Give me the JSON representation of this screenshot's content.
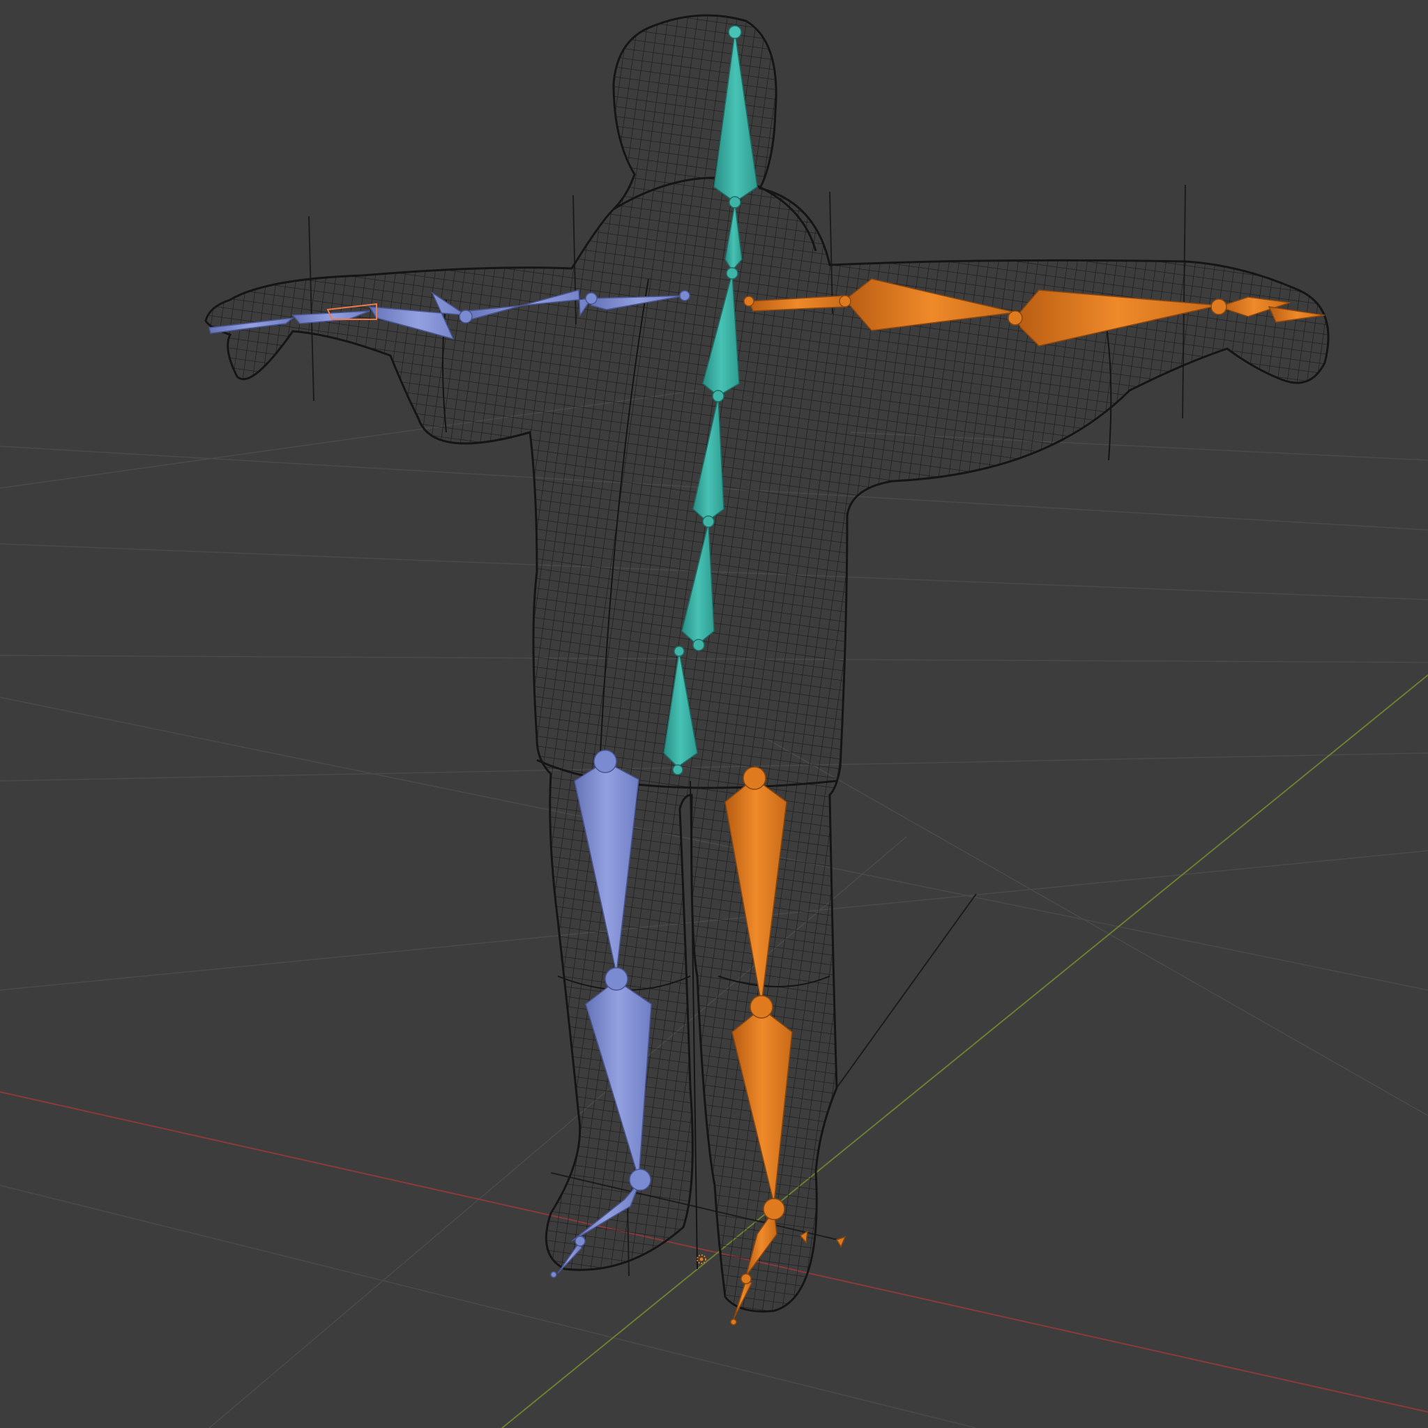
{
  "viewport": {
    "background": "#3d3d3d",
    "grid_color": "#474747",
    "x_axis_color": "#8a3a3a",
    "y_axis_color": "#6a7f32"
  },
  "mesh": {
    "wire_color": "#151515",
    "display": "wireframe"
  },
  "armature": {
    "center_color": "#3fb5a8",
    "left_color": "#7b8bd1",
    "right_color": "#e07a1e",
    "selected_outline": "#f07a4a"
  },
  "icons": {
    "origin": "object-origin-icon"
  }
}
